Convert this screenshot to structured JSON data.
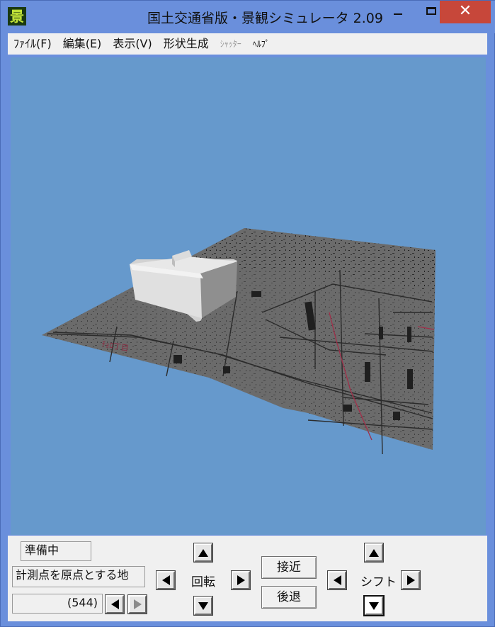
{
  "window": {
    "icon_glyph": "景",
    "title": "国土交通省版・景観シミュレータ 2.09",
    "close_glyph": "✕"
  },
  "menu": [
    {
      "label": "ﾌｧｲﾙ(F)",
      "small": false,
      "disabled": false
    },
    {
      "label": "編集(E)",
      "small": false,
      "disabled": false
    },
    {
      "label": "表示(V)",
      "small": false,
      "disabled": false
    },
    {
      "label": "形状生成",
      "small": false,
      "disabled": false
    },
    {
      "label": "ｼｬｯﾀｰ",
      "small": true,
      "disabled": true
    },
    {
      "label": "ﾍﾙﾌﾟ",
      "small": true,
      "disabled": false
    }
  ],
  "viewport": {
    "background": "#6699cc",
    "terrain_color": "#6b6b6b",
    "building_colors": {
      "top": "#e4e4e4",
      "front": "#d8d8d8",
      "side": "#8c8c8c"
    },
    "map_text": "ﾁｮﾛ丁目"
  },
  "panel": {
    "status": "準備中",
    "measure": "計測点を原点とする地",
    "count": "(544)",
    "rotate_label": "回転",
    "approach_label": "接近",
    "retreat_label": "後退",
    "shift_label": "シフト"
  }
}
